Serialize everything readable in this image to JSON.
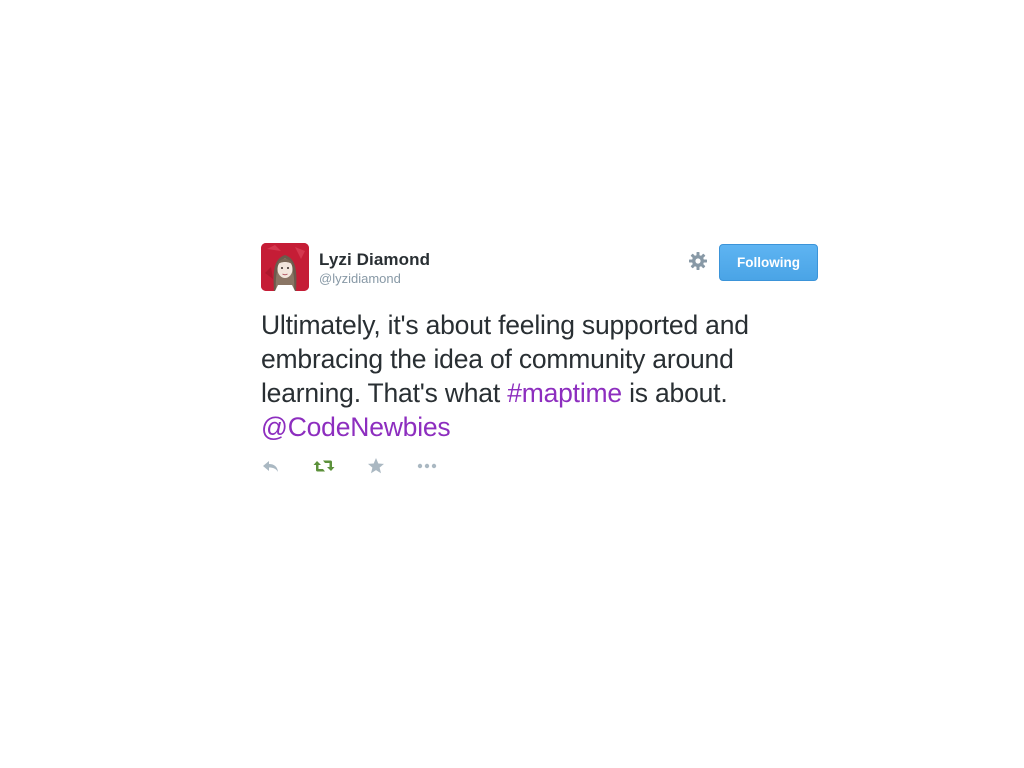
{
  "tweet": {
    "author": {
      "display_name": "Lyzi Diamond",
      "username": "@lyzidiamond"
    },
    "follow_button_label": "Following",
    "text_segments": {
      "part1": "Ultimately, it's about feeling supported and embracing the idea of community around learning. That's what ",
      "hashtag": "#maptime",
      "part2": " is about. ",
      "mention": "@CodeNewbies"
    },
    "actions": [
      {
        "icon": "reply-icon",
        "color": "#aab8c2"
      },
      {
        "icon": "retweet-icon",
        "color": "#5c913b"
      },
      {
        "icon": "favorite-star-icon",
        "color": "#aab8c2"
      },
      {
        "icon": "more-dots-icon",
        "color": "#aab8c2"
      }
    ],
    "colors": {
      "link": "#8d2ebf",
      "button": "#55acee",
      "text": "#292f33",
      "muted": "#8899a6"
    }
  }
}
